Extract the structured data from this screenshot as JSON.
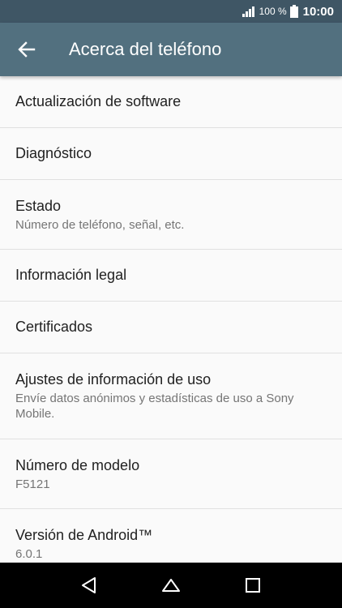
{
  "status_bar": {
    "battery_percent": "100 %",
    "time": "10:00",
    "icons": [
      "signal-icon",
      "battery-icon"
    ]
  },
  "toolbar": {
    "title": "Acerca del teléfono",
    "back_icon": "arrow-left-icon"
  },
  "items": [
    {
      "primary": "Actualización de software",
      "secondary": ""
    },
    {
      "primary": "Diagnóstico",
      "secondary": ""
    },
    {
      "primary": "Estado",
      "secondary": "Número de teléfono, señal, etc."
    },
    {
      "primary": "Información legal",
      "secondary": ""
    },
    {
      "primary": "Certificados",
      "secondary": ""
    },
    {
      "primary": "Ajustes de información de uso",
      "secondary": "Envíe datos anónimos y estadísticas de uso a Sony Mobile."
    },
    {
      "primary": "Número de modelo",
      "secondary": "F5121"
    },
    {
      "primary": "Versión de Android™",
      "secondary": "6.0.1"
    }
  ],
  "nav_bar": {
    "icons": [
      "back-triangle-icon",
      "home-circle-icon",
      "recents-square-icon"
    ]
  },
  "colors": {
    "status_bar": "#3f5665",
    "toolbar": "#52707f",
    "background": "#fafafa"
  }
}
